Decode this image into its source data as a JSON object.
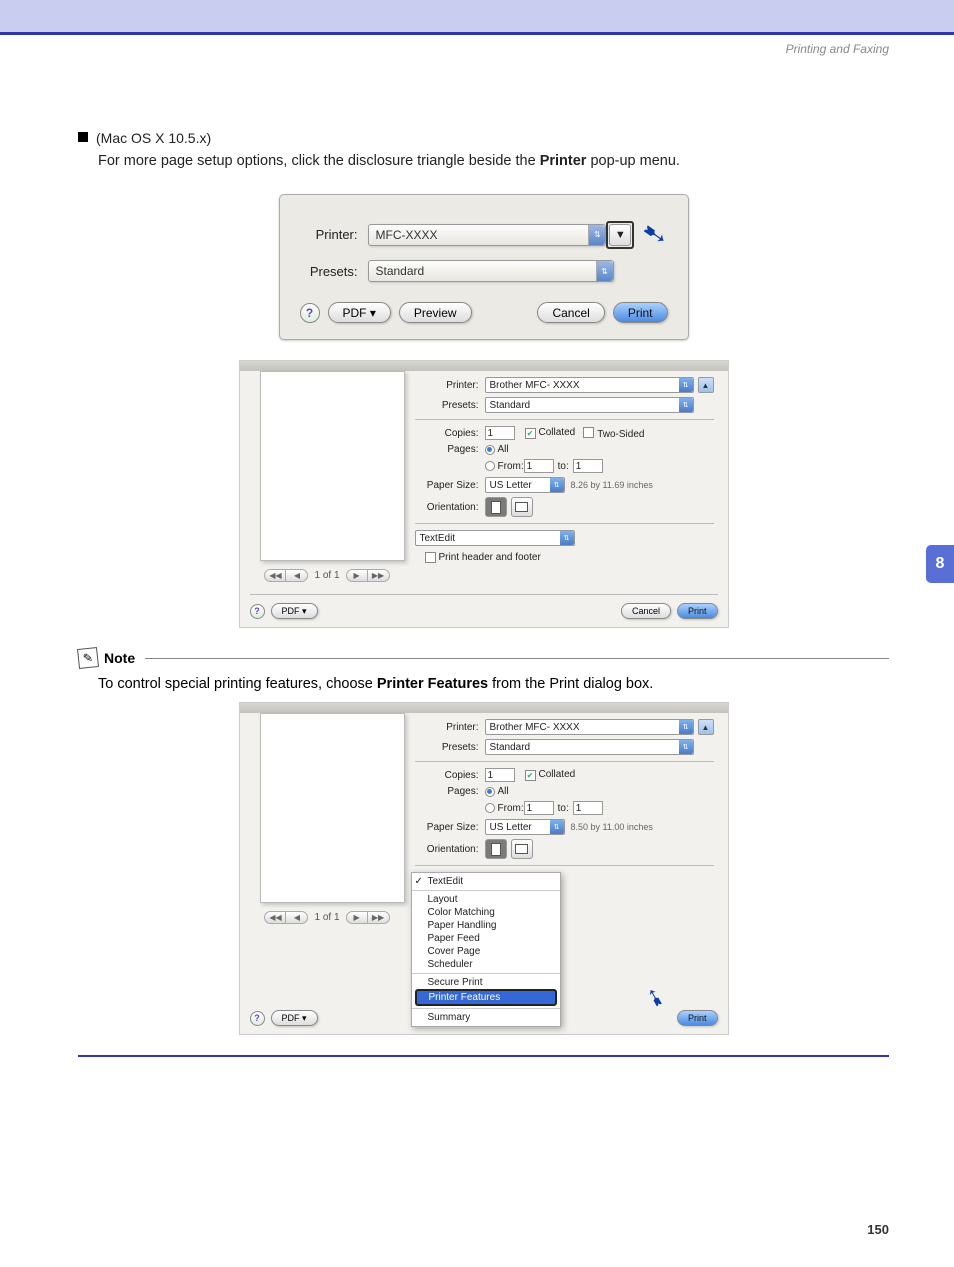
{
  "header": {
    "section": "Printing and Faxing"
  },
  "body": {
    "bullet_text": "(Mac OS X 10.5.x)",
    "sub_text_pre": "For more page setup options, click the disclosure triangle beside the ",
    "sub_text_bold": "Printer",
    "sub_text_post": " pop-up menu."
  },
  "dialog1": {
    "printer_label": "Printer:",
    "printer_value": "MFC-XXXX",
    "presets_label": "Presets:",
    "presets_value": "Standard",
    "pdf_label": "PDF ▾",
    "preview_label": "Preview",
    "cancel_label": "Cancel",
    "print_label": "Print"
  },
  "dialog2": {
    "printer_label": "Printer:",
    "printer_value": "Brother MFC- XXXX",
    "presets_label": "Presets:",
    "presets_value": "Standard",
    "copies_label": "Copies:",
    "copies_value": "1",
    "collated": "Collated",
    "two_sided": "Two-Sided",
    "pages_label": "Pages:",
    "all": "All",
    "from": "From:",
    "from_val": "1",
    "to": "to:",
    "to_val": "1",
    "paper_size_label": "Paper Size:",
    "paper_size_value": "US Letter",
    "paper_dims": "8.26 by 11.69 inches",
    "orientation_label": "Orientation:",
    "panel": "TextEdit",
    "header_footer": "Print header and footer",
    "page_of": "1 of 1",
    "pdf_label": "PDF ▾",
    "cancel_label": "Cancel",
    "print_label": "Print"
  },
  "note": {
    "word": "Note",
    "text_pre": "To control special printing features, choose ",
    "text_bold": "Printer Features",
    "text_post": " from the Print dialog box."
  },
  "dialog3": {
    "printer_label": "Printer:",
    "printer_value": "Brother MFC- XXXX",
    "presets_label": "Presets:",
    "presets_value": "Standard",
    "copies_label": "Copies:",
    "copies_value": "1",
    "collated": "Collated",
    "pages_label": "Pages:",
    "all": "All",
    "from": "From:",
    "from_val": "1",
    "to": "to:",
    "to_val": "1",
    "paper_size_label": "Paper Size:",
    "paper_size_value": "US Letter",
    "paper_dims": "8.50 by 11.00 inches",
    "orientation_label": "Orientation:",
    "page_of": "1 of 1",
    "pdf_label": "PDF ▾",
    "print_label": "Print",
    "menu": {
      "textedit": "TextEdit",
      "layout": "Layout",
      "color_matching": "Color Matching",
      "paper_handling": "Paper Handling",
      "paper_feed": "Paper Feed",
      "cover_page": "Cover Page",
      "scheduler": "Scheduler",
      "secure_print": "Secure Print",
      "printer_features": "Printer Features",
      "summary": "Summary"
    }
  },
  "sidebar": {
    "chapter": "8"
  },
  "footer": {
    "page": "150"
  }
}
